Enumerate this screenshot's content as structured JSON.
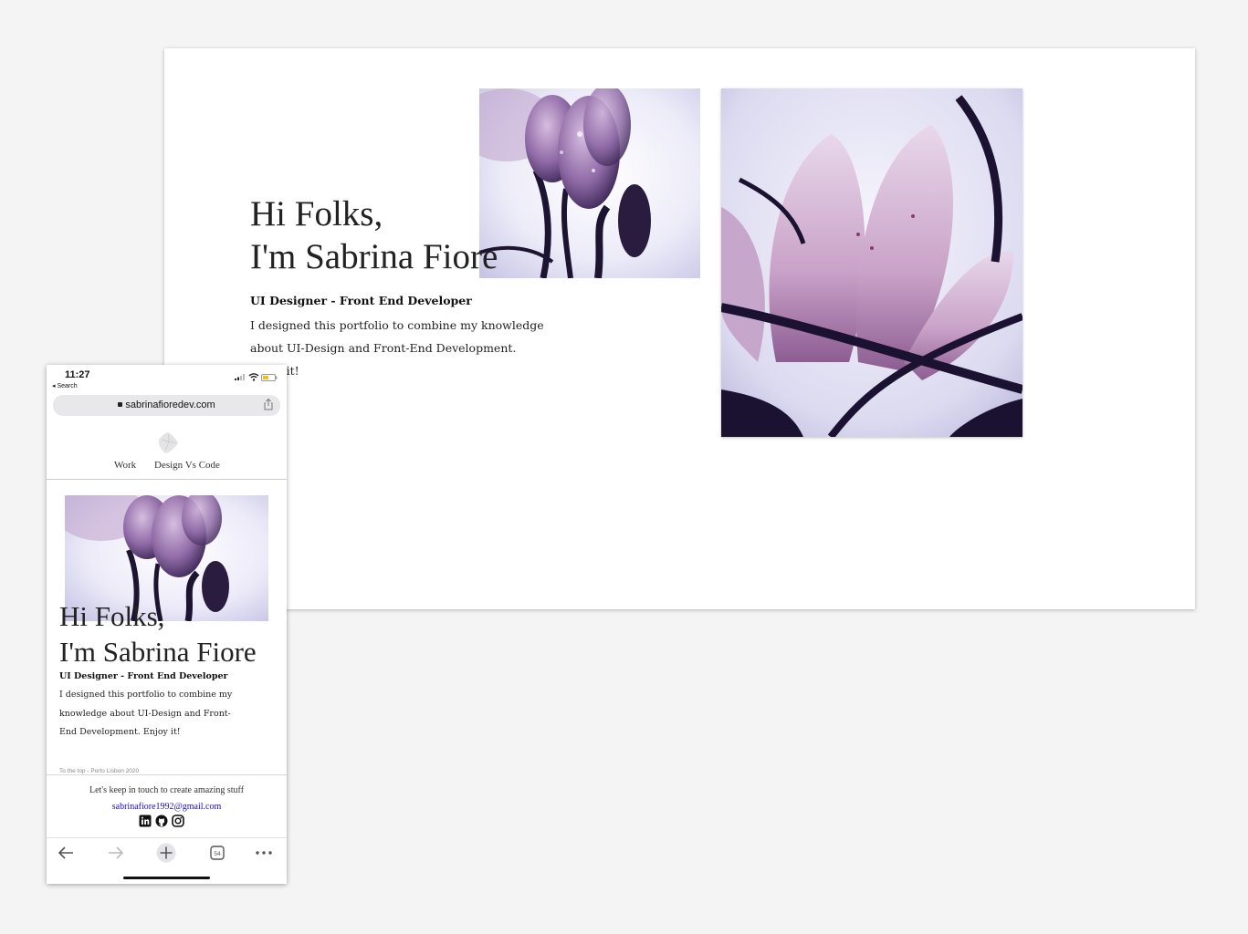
{
  "desktop": {
    "heading_line1": "Hi Folks,",
    "heading_line2": "I'm Sabrina Fiore",
    "role": "UI Designer - Front End Developer",
    "description": "I designed this portfolio to combine my knowledge about UI-Design and Front-End Development. Enjoy it!"
  },
  "phone": {
    "status": {
      "time": "11:27",
      "back_label": "◂ Search"
    },
    "url": "sabrinafioredev.com",
    "nav": {
      "work_label": "Work",
      "design_vs_code_label": "Design Vs Code"
    },
    "heading_line1": "Hi Folks,",
    "heading_line2": "I'm Sabrina Fiore",
    "role": "UI Designer - Front End Developer",
    "description": "I designed this portfolio to combine my knowledge about UI-Design and Front-End Development. Enjoy it!",
    "footnote": "To the top - Porto Lisbon 2020",
    "contact": {
      "text": "Let's keep in touch to create amazing stuff",
      "email": "sabrinafiore1992@gmail.com",
      "social_icons": [
        "linkedin-icon",
        "github-icon",
        "instagram-icon"
      ]
    },
    "toolbar": {
      "icons": [
        "back-arrow-icon",
        "forward-arrow-icon",
        "new-tab-plus-icon",
        "tabs-count-icon",
        "more-dots-icon"
      ],
      "tabs_count": "54"
    }
  },
  "colors": {
    "page_background": "#f4f4f4",
    "link": "#1a0dcc",
    "flower_light": "#c9a6cf",
    "flower_dark": "#201433",
    "sky": "#ecebf7"
  }
}
